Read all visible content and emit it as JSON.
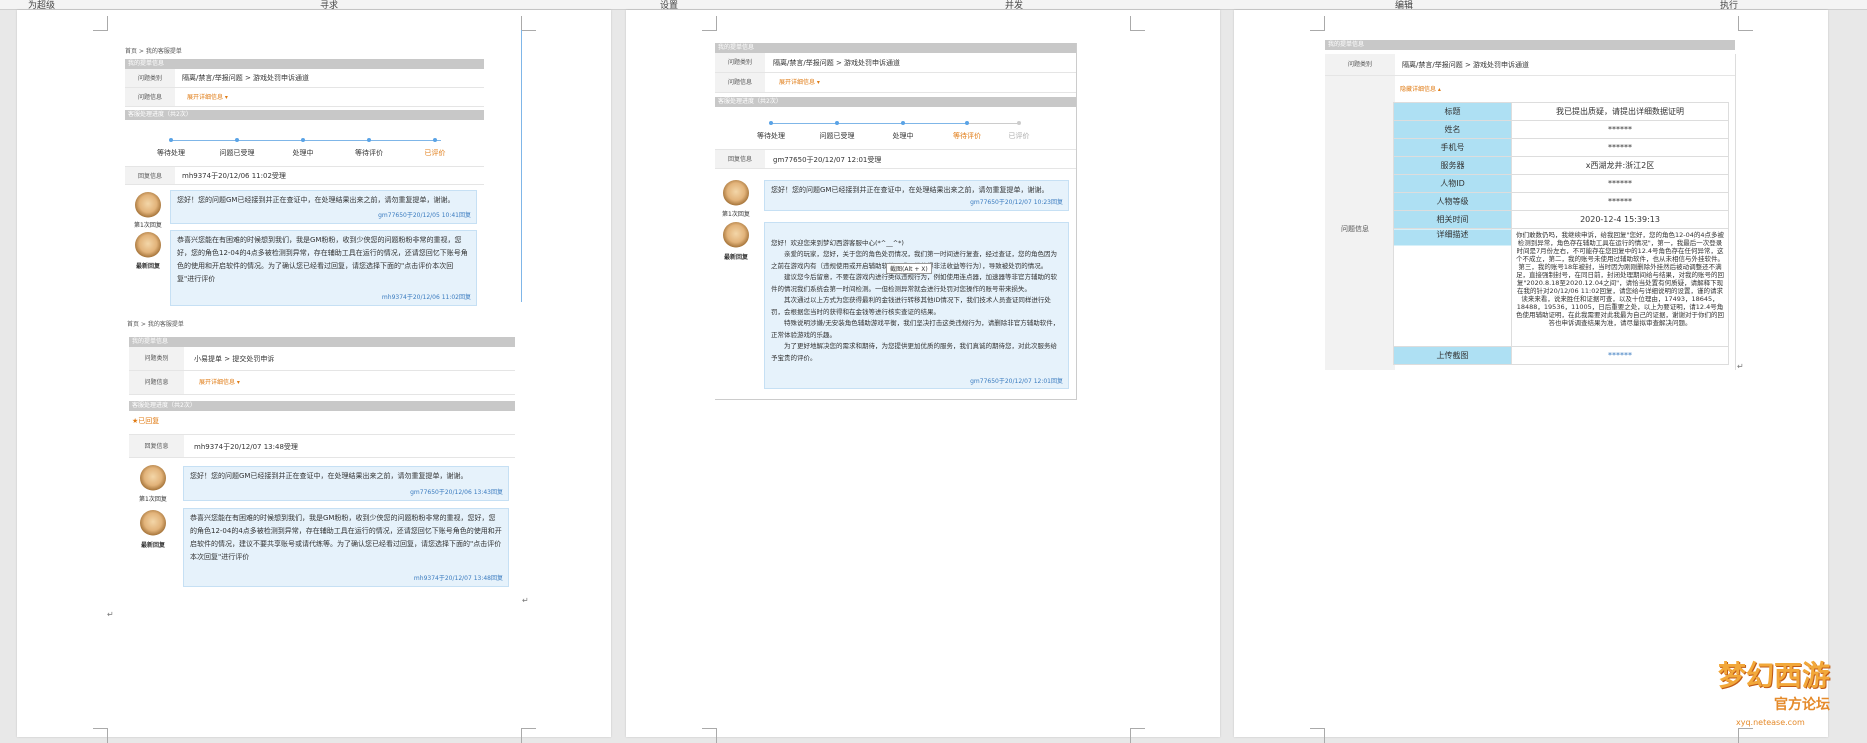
{
  "topbar": {
    "items": [
      "为超级",
      "寻求",
      "设置",
      "并发",
      "编辑",
      "执行"
    ]
  },
  "page1": {
    "top": {
      "breadcrumb": "首页 > 我的客服提单",
      "section_title": "我的提单信息",
      "rows": [
        {
          "label": "问题类别",
          "value": "隔离/禁言/举报问题 > 游戏处罚申诉通道"
        },
        {
          "label": "问题信息",
          "value": "展开详细信息 ▾"
        }
      ],
      "progress_title": "客服处理进度（共2次）",
      "steps": [
        "等待处理",
        "问题已受理",
        "处理中",
        "等待评价",
        "已评价"
      ],
      "reply_info": {
        "label": "回复信息",
        "value": "mh9374于20/12/06 11:02受理"
      },
      "msg1": {
        "avatar_label": "第1次回复",
        "text": "您好！您的问题GM已经接到并正在查证中，在处理结果出来之前，请勿重复提单，谢谢。",
        "meta": "gm77650于20/12/05 10:41回复"
      },
      "msg2": {
        "avatar_label": "最新回复",
        "text": "恭喜兴您能在有困难的时候想到我们，我是GM粉粉，收到少侠您的问题粉粉非常的重视，您好，您的角色12-04的4点多被检测到异常，存在辅助工具在运行的情况，还请您回忆下账号角色的使用和开启软件的情况。为了确认您已经看过回复，请您选择下面的\"点击评价本次回复\"进行评价",
        "meta": "mh9374于20/12/06 11:02回复"
      }
    },
    "bottom": {
      "breadcrumb": "首页 > 我的客服提单",
      "section_title": "我的提单信息",
      "rows": [
        {
          "label": "问题类别",
          "value": "小易提单 > 提交处罚申诉"
        },
        {
          "label": "问题信息",
          "value": "展开详细信息 ▾"
        }
      ],
      "progress_title": "客服处理进度（共2次）",
      "status": "★已回复",
      "reply_info": {
        "label": "回复信息",
        "value": "mh9374于20/12/07 13:48受理"
      },
      "msg1": {
        "avatar_label": "第1次回复",
        "text": "您好！您的问题GM已经接到并正在查证中，在处理结果出来之前，请勿重复提单，谢谢。",
        "meta": "gm77650于20/12/06 13:43回复"
      },
      "msg2": {
        "avatar_label": "最新回复",
        "text": "恭喜兴您能在有困难的时候想到我们，我是GM粉粉，收到少侠您的问题粉粉非常的重视，您好，您的角色12-04的4点多被检测到异常，存在辅助工具在运行的情况，还请您回忆下账号角色的使用和开启软件的情况，建议不要共享账号或请代练等。为了确认您已经看过回复，请您选择下面的\"点击评价本次回复\"进行评价",
        "meta": "mh9374于20/12/07 13:48回复"
      }
    }
  },
  "page2": {
    "section_title": "我的提单信息",
    "rows": [
      {
        "label": "问题类别",
        "value": "隔离/禁言/举报问题 > 游戏处罚申诉通道"
      },
      {
        "label": "问题信息",
        "value": "展开详细信息 ▾"
      }
    ],
    "progress_title": "客服处理进度（共2次）",
    "steps": [
      "等待处理",
      "问题已受理",
      "处理中",
      "等待评价",
      "已评价"
    ],
    "reply_info": {
      "label": "回复信息",
      "value": "gm77650于20/12/07 12:01受理"
    },
    "msg1": {
      "avatar_label": "第1次回复",
      "text": "您好！您的问题GM已经接到并正在查证中，在处理结果出来之前，请勿重复提单，谢谢。",
      "meta": "gm77650于20/12/07 10:23回复"
    },
    "msg2": {
      "avatar_label": "最新回复",
      "text": "您好！欢迎您来到梦幻西游客服中心(*^__^*)\n　　亲爱的玩家，您好，关于您的角色处罚情况，我们第一时间进行复查，经过查证，您的角色因为之前在游戏内有（违规使用或开启辅助软件，或无偿获得非法收益等行为），导致被处罚的情况。\n　　建议您今后留意，不要在游戏内进行类似违规行为，例如使用连点器，加速器等非官方辅助的软件的情况我们系统会第一时间检测。一但检测异常就会进行处罚对您操作的账号带来损失。\n　　其次通过以上方式为您获得最利的金钱进行转移其他ID情况下，我们技术人员查证同样进行处罚，会根据您当时的获得和在金钱等进行核实查证的结果。\n　　特殊说明涉嫌/无安装角色辅助游戏平衡，我们坚决打击这类违规行为，请删除非官方辅助软件，正常体验游戏的乐趣。\n　　为了更好地解决您的需求和期待，为您提供更加优质的服务，我们真诚的期待您，对此次服务给予宝贵的评价。",
      "meta": "gm77650于20/12/07 12:01回复"
    },
    "tooltip": "截图(Alt + X)"
  },
  "page3": {
    "section_title": "我的提单信息",
    "category": {
      "label": "问题类别",
      "value": "隔离/禁言/举报问题 > 游戏处罚申诉通道"
    },
    "info_label": "问题信息",
    "collapse_link": "隐藏详细信息 ▴",
    "table": [
      {
        "k": "标题",
        "v": "我已提出质疑，请提出详细数据证明"
      },
      {
        "k": "姓名",
        "v": "******"
      },
      {
        "k": "手机号",
        "v": "******"
      },
      {
        "k": "服务器",
        "v": "x西湖龙井:浙江2区"
      },
      {
        "k": "人物ID",
        "v": "******"
      },
      {
        "k": "人物等级",
        "v": "******"
      },
      {
        "k": "相关时间",
        "v": "2020-12-4 15:39:13"
      }
    ],
    "detail_label": "详细描述",
    "detail_text": "你们敢数仍吗，我继续申诉，给我回复\"您好，您的角色12-04的4点多被检测到异常，角色存在辅助工具在运行的情况\"，第一，我最后一次登录时间是7月份左右，不可能存在您回复中的12.4号角色存在任何异常，这个不成立，第二，我的账号未使用过辅助软件，也从未相信与外挂软件。第三，我的账号18年被封，当时因为刚刚删除外挂然后被动调整还不满足，直接强制封号，在同日前，封闭处理期间给与结果，对我的账号的回复\"2020.8.18至2020.12.04之间\"，请恰当处置有何质疑，请解释下现在我的针对20/12/06 11:02回复，请您给与详细说明的设置，谨的请求读来来看，说来胜任和证据可查，以及十位理由，17493，18645，18488，19536，11005，日后重要之处，以上为要证明，请12.4号角色使用辅助证明，在此我需要对此我最为自己的证据，谢谢对于你们的回答也申诉调查结果为准，请尽量拟审查解决问题。",
    "upload_label": "上传截图",
    "upload_value": "******"
  },
  "enter_mark": "↵",
  "logo": {
    "title": "梦幻西游",
    "subtitle": "官方论坛",
    "url": "xyq.netease.com"
  },
  "colors": {
    "accent_blue": "#5aa3e6",
    "orange": "#e07b14",
    "table_key_bg": "#aee0f3",
    "bubble_bg": "#e6f2fb"
  }
}
